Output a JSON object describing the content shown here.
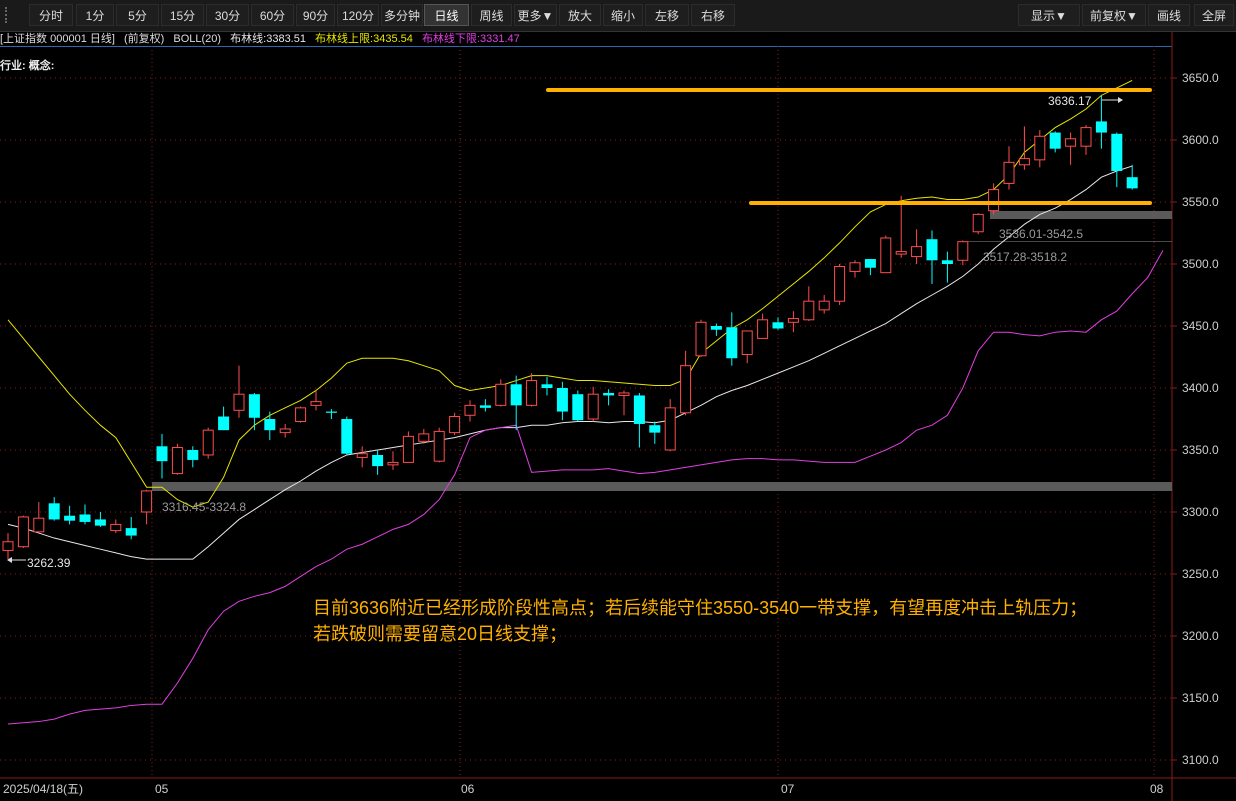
{
  "toolbar": {
    "left": [
      {
        "id": "fenshi",
        "label": "分时"
      },
      {
        "id": "1m",
        "label": "1分"
      },
      {
        "id": "5m",
        "label": "5分"
      },
      {
        "id": "15m",
        "label": "15分"
      },
      {
        "id": "30m",
        "label": "30分"
      },
      {
        "id": "60m",
        "label": "60分"
      },
      {
        "id": "90m",
        "label": "90分"
      },
      {
        "id": "120m",
        "label": "120分"
      },
      {
        "id": "multi",
        "label": "多分钟"
      },
      {
        "id": "day",
        "label": "日线",
        "active": true
      },
      {
        "id": "week",
        "label": "周线"
      },
      {
        "id": "more",
        "label": "更多▼"
      },
      {
        "id": "zoomin",
        "label": "放大"
      },
      {
        "id": "zoomout",
        "label": "缩小"
      },
      {
        "id": "left",
        "label": "左移"
      },
      {
        "id": "right",
        "label": "右移"
      }
    ],
    "right": [
      {
        "id": "display",
        "label": "显示▼"
      },
      {
        "id": "adjust",
        "label": "前复权▼"
      },
      {
        "id": "draw",
        "label": "画线"
      },
      {
        "id": "fullscreen",
        "label": "全屏"
      }
    ]
  },
  "info": {
    "symbol": "[上证指数 000001 日线]",
    "adjust": "(前复权)",
    "indicator": "BOLL(20)",
    "mid_label": "布林线:3383.51",
    "upper_label": "布林线上限:3435.54",
    "lower_label": "布林线下限:3331.47"
  },
  "industry_label": "行业: 概念:",
  "colors": {
    "up": "#ff4d4d",
    "down": "#00ffff",
    "boll_mid": "#e8e8e8",
    "boll_upper": "#e6e600",
    "boll_lower": "#e040e0",
    "highlight": "#ffb000",
    "zone": "#5a5a5a",
    "grid": "#8b1a1a"
  },
  "chart_data": {
    "type": "candlestick",
    "y_axis": {
      "min": 3100,
      "max": 3650,
      "ticks": [
        "3100.0",
        "3150.0",
        "3200.0",
        "3250.0",
        "3300.0",
        "3350.0",
        "3400.0",
        "3450.0",
        "3500.0",
        "3550.0",
        "3600.0",
        "3650.0"
      ]
    },
    "x_axis": {
      "labels": [
        "2025/04/18(五)",
        "05",
        "06",
        "07",
        "08"
      ]
    },
    "candles": [
      {
        "o": 3269,
        "h": 3283,
        "l": 3262,
        "c": 3276
      },
      {
        "o": 3272,
        "h": 3297,
        "l": 3271,
        "c": 3296
      },
      {
        "o": 3284,
        "h": 3308,
        "l": 3283,
        "c": 3295
      },
      {
        "o": 3307,
        "h": 3312,
        "l": 3293,
        "c": 3294
      },
      {
        "o": 3297,
        "h": 3305,
        "l": 3290,
        "c": 3293
      },
      {
        "o": 3298,
        "h": 3306,
        "l": 3290,
        "c": 3292
      },
      {
        "o": 3294,
        "h": 3300,
        "l": 3288,
        "c": 3289
      },
      {
        "o": 3285,
        "h": 3294,
        "l": 3283,
        "c": 3290
      },
      {
        "o": 3287,
        "h": 3296,
        "l": 3278,
        "c": 3281
      },
      {
        "o": 3300,
        "h": 3318,
        "l": 3290,
        "c": 3317
      },
      {
        "o": 3353,
        "h": 3363,
        "l": 3327,
        "c": 3341
      },
      {
        "o": 3331,
        "h": 3355,
        "l": 3330,
        "c": 3352
      },
      {
        "o": 3350,
        "h": 3353,
        "l": 3336,
        "c": 3342
      },
      {
        "o": 3346,
        "h": 3368,
        "l": 3343,
        "c": 3366
      },
      {
        "o": 3377,
        "h": 3385,
        "l": 3366,
        "c": 3366
      },
      {
        "o": 3382,
        "h": 3418,
        "l": 3376,
        "c": 3395
      },
      {
        "o": 3395,
        "h": 3396,
        "l": 3366,
        "c": 3376
      },
      {
        "o": 3375,
        "h": 3381,
        "l": 3358,
        "c": 3366
      },
      {
        "o": 3364,
        "h": 3371,
        "l": 3360,
        "c": 3367
      },
      {
        "o": 3373,
        "h": 3385,
        "l": 3372,
        "c": 3384
      },
      {
        "o": 3386,
        "h": 3398,
        "l": 3382,
        "c": 3389
      },
      {
        "o": 3381,
        "h": 3383,
        "l": 3375,
        "c": 3380
      },
      {
        "o": 3375,
        "h": 3377,
        "l": 3346,
        "c": 3347
      },
      {
        "o": 3344,
        "h": 3353,
        "l": 3336,
        "c": 3347
      },
      {
        "o": 3346,
        "h": 3350,
        "l": 3330,
        "c": 3337
      },
      {
        "o": 3338,
        "h": 3349,
        "l": 3334,
        "c": 3340
      },
      {
        "o": 3340,
        "h": 3365,
        "l": 3340,
        "c": 3361
      },
      {
        "o": 3357,
        "h": 3367,
        "l": 3355,
        "c": 3363
      },
      {
        "o": 3341,
        "h": 3368,
        "l": 3340,
        "c": 3365
      },
      {
        "o": 3364,
        "h": 3380,
        "l": 3362,
        "c": 3377
      },
      {
        "o": 3378,
        "h": 3390,
        "l": 3373,
        "c": 3386
      },
      {
        "o": 3386,
        "h": 3391,
        "l": 3381,
        "c": 3384
      },
      {
        "o": 3386,
        "h": 3407,
        "l": 3385,
        "c": 3403
      },
      {
        "o": 3403,
        "h": 3410,
        "l": 3366,
        "c": 3386
      },
      {
        "o": 3386,
        "h": 3412,
        "l": 3385,
        "c": 3406
      },
      {
        "o": 3403,
        "h": 3409,
        "l": 3394,
        "c": 3400
      },
      {
        "o": 3400,
        "h": 3405,
        "l": 3374,
        "c": 3381
      },
      {
        "o": 3395,
        "h": 3398,
        "l": 3373,
        "c": 3374
      },
      {
        "o": 3375,
        "h": 3401,
        "l": 3373,
        "c": 3395
      },
      {
        "o": 3396,
        "h": 3399,
        "l": 3386,
        "c": 3394
      },
      {
        "o": 3394,
        "h": 3398,
        "l": 3378,
        "c": 3396
      },
      {
        "o": 3394,
        "h": 3396,
        "l": 3352,
        "c": 3371
      },
      {
        "o": 3370,
        "h": 3373,
        "l": 3355,
        "c": 3364
      },
      {
        "o": 3350,
        "h": 3391,
        "l": 3349,
        "c": 3384
      },
      {
        "o": 3380,
        "h": 3430,
        "l": 3378,
        "c": 3418
      },
      {
        "o": 3426,
        "h": 3455,
        "l": 3425,
        "c": 3453
      },
      {
        "o": 3450,
        "h": 3452,
        "l": 3442,
        "c": 3447
      },
      {
        "o": 3449,
        "h": 3461,
        "l": 3418,
        "c": 3424
      },
      {
        "o": 3427,
        "h": 3446,
        "l": 3420,
        "c": 3446
      },
      {
        "o": 3440,
        "h": 3460,
        "l": 3440,
        "c": 3455
      },
      {
        "o": 3453,
        "h": 3457,
        "l": 3447,
        "c": 3448
      },
      {
        "o": 3453,
        "h": 3462,
        "l": 3445,
        "c": 3456
      },
      {
        "o": 3455,
        "h": 3482,
        "l": 3454,
        "c": 3470
      },
      {
        "o": 3463,
        "h": 3475,
        "l": 3460,
        "c": 3470
      },
      {
        "o": 3470,
        "h": 3500,
        "l": 3467,
        "c": 3498
      },
      {
        "o": 3494,
        "h": 3503,
        "l": 3489,
        "c": 3501
      },
      {
        "o": 3504,
        "h": 3503,
        "l": 3491,
        "c": 3497
      },
      {
        "o": 3493,
        "h": 3523,
        "l": 3493,
        "c": 3521
      },
      {
        "o": 3508,
        "h": 3555,
        "l": 3505,
        "c": 3510
      },
      {
        "o": 3506,
        "h": 3528,
        "l": 3500,
        "c": 3514
      },
      {
        "o": 3520,
        "h": 3527,
        "l": 3484,
        "c": 3503
      },
      {
        "o": 3503,
        "h": 3510,
        "l": 3485,
        "c": 3500
      },
      {
        "o": 3503,
        "h": 3519,
        "l": 3499,
        "c": 3518
      },
      {
        "o": 3526,
        "h": 3541,
        "l": 3524,
        "c": 3540
      },
      {
        "o": 3543,
        "h": 3565,
        "l": 3540,
        "c": 3560
      },
      {
        "o": 3565,
        "h": 3595,
        "l": 3560,
        "c": 3582
      },
      {
        "o": 3580,
        "h": 3611,
        "l": 3576,
        "c": 3585
      },
      {
        "o": 3584,
        "h": 3608,
        "l": 3578,
        "c": 3603
      },
      {
        "o": 3606,
        "h": 3607,
        "l": 3590,
        "c": 3593
      },
      {
        "o": 3595,
        "h": 3606,
        "l": 3580,
        "c": 3601
      },
      {
        "o": 3595,
        "h": 3612,
        "l": 3588,
        "c": 3610
      },
      {
        "o": 3615,
        "h": 3636,
        "l": 3593,
        "c": 3606
      },
      {
        "o": 3605,
        "h": 3606,
        "l": 3562,
        "c": 3575
      },
      {
        "o": 3570,
        "h": 3580,
        "l": 3560,
        "c": 3561
      }
    ],
    "boll_upper": [
      3455,
      3440,
      3425,
      3410,
      3395,
      3382,
      3370,
      3360,
      3340,
      3320,
      3320,
      3310,
      3304,
      3308,
      3328,
      3358,
      3370,
      3378,
      3384,
      3390,
      3398,
      3408,
      3420,
      3424,
      3424,
      3424,
      3422,
      3418,
      3414,
      3402,
      3398,
      3400,
      3402,
      3406,
      3410,
      3410,
      3408,
      3406,
      3406,
      3405,
      3404,
      3403,
      3402,
      3402,
      3407,
      3428,
      3438,
      3448,
      3455,
      3464,
      3474,
      3484,
      3494,
      3505,
      3517,
      3530,
      3542,
      3548,
      3551,
      3553,
      3554,
      3552,
      3552,
      3554,
      3560,
      3572,
      3590,
      3600,
      3610,
      3617,
      3625,
      3636,
      3642,
      3648
    ],
    "boll_mid": [
      3290,
      3287,
      3283,
      3279,
      3276,
      3273,
      3270,
      3267,
      3264,
      3262,
      3262,
      3262,
      3262,
      3272,
      3283,
      3294,
      3302,
      3310,
      3318,
      3325,
      3333,
      3340,
      3346,
      3348,
      3350,
      3352,
      3354,
      3356,
      3358,
      3360,
      3363,
      3366,
      3368,
      3368,
      3370,
      3370,
      3372,
      3373,
      3373,
      3372,
      3373,
      3373,
      3372,
      3374,
      3380,
      3386,
      3393,
      3398,
      3402,
      3407,
      3412,
      3417,
      3422,
      3428,
      3434,
      3440,
      3446,
      3452,
      3460,
      3468,
      3475,
      3482,
      3490,
      3500,
      3512,
      3522,
      3532,
      3540,
      3545,
      3552,
      3560,
      3570,
      3575,
      3579
    ],
    "boll_lower": [
      3129,
      3130,
      3131,
      3133,
      3137,
      3140,
      3141,
      3142,
      3144,
      3145,
      3145,
      3162,
      3182,
      3205,
      3220,
      3228,
      3232,
      3235,
      3240,
      3248,
      3256,
      3262,
      3270,
      3274,
      3280,
      3286,
      3290,
      3298,
      3310,
      3330,
      3360,
      3366,
      3368,
      3370,
      3332,
      3333,
      3334,
      3334,
      3334,
      3335,
      3333,
      3331,
      3332,
      3334,
      3336,
      3338,
      3340,
      3342,
      3343,
      3343,
      3342,
      3342,
      3341,
      3340,
      3340,
      3340,
      3345,
      3350,
      3356,
      3366,
      3370,
      3378,
      3400,
      3430,
      3445,
      3445,
      3443,
      3442,
      3445,
      3446,
      3445,
      3455,
      3462,
      3476,
      3489,
      3511
    ],
    "support_zones": [
      {
        "label": "3316.45-3324.8",
        "lo": 3316.45,
        "hi": 3324.8,
        "from": 9
      },
      {
        "label": "3536.01-3542.5",
        "lo": 3536.01,
        "hi": 3542.5,
        "from": 63
      },
      {
        "label": "3517.28-3518.2",
        "lo": 3517.28,
        "hi": 3518.2,
        "from": 61
      }
    ],
    "horizontal_lines": [
      {
        "value": 3640,
        "from": 33,
        "to": 73
      },
      {
        "value": 3549,
        "from": 45,
        "to": 75
      }
    ],
    "markers": [
      {
        "label": "3636.17",
        "value": 3636.17,
        "index": 71
      },
      {
        "label": "3262.39",
        "value": 3262.39,
        "index": 0
      }
    ],
    "annotation": [
      "目前3636附近已经形成阶段性高点；若后续能守住3550-3540一带支撑，有望再度冲击上轨压力；",
      "若跌破则需要留意20日线支撑；"
    ]
  }
}
